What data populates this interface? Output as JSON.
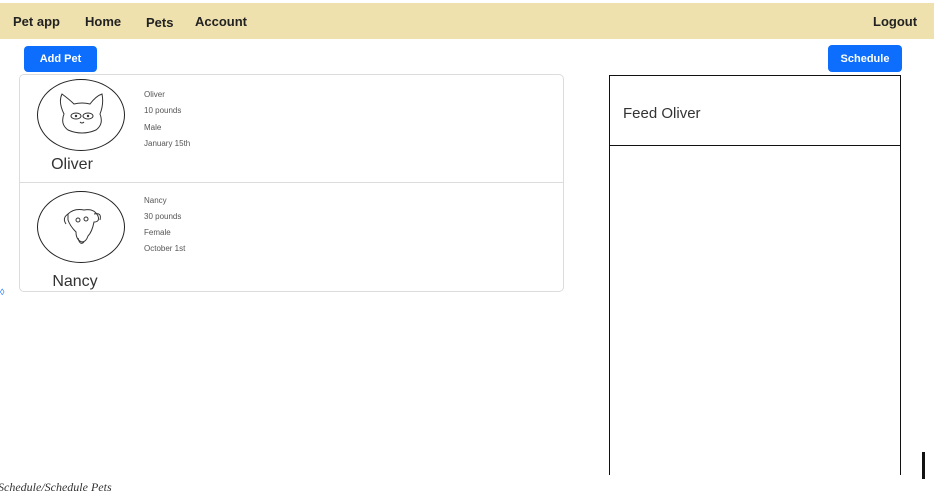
{
  "navbar": {
    "brand": "Pet app",
    "home": "Home",
    "pets": "Pets",
    "account": "Account",
    "logout": "Logout"
  },
  "toolbar": {
    "add_pet_label": "Add Pet",
    "schedule_label": "Schedule"
  },
  "pets": [
    {
      "display_name": "Oliver",
      "details": [
        "Oliver",
        "10 pounds",
        "Male",
        "January 15th"
      ],
      "avatar_icon": "cat-icon"
    },
    {
      "display_name": "Nancy",
      "details": [
        "Nancy",
        "30 pounds",
        "Female",
        "October 1st"
      ],
      "avatar_icon": "dog-icon"
    }
  ],
  "schedule": {
    "tasks": [
      "Feed Oliver"
    ]
  },
  "footer": {
    "text": "Schedule/Schedule Pets"
  },
  "colors": {
    "navbar_bg": "#eee1ad",
    "primary": "#0d6efd"
  }
}
